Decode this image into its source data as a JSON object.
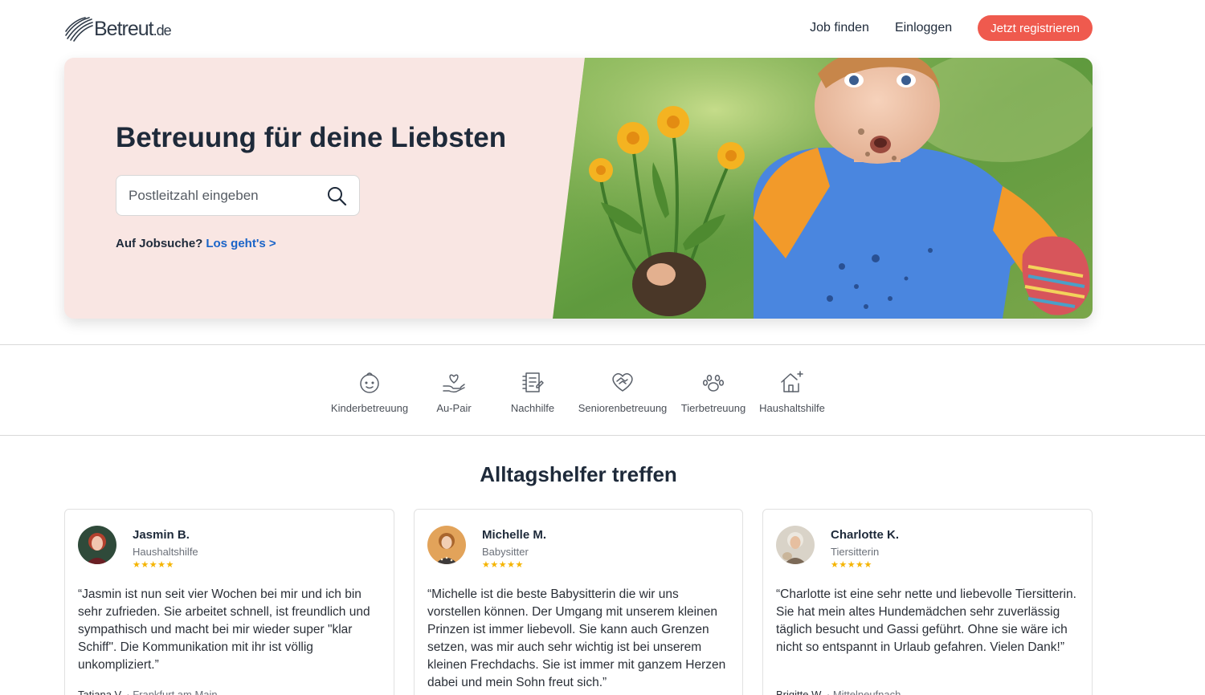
{
  "header": {
    "logo_text": "Betreut",
    "logo_tld": ".de",
    "nav": {
      "job_finden": "Job finden",
      "einloggen": "Einloggen",
      "register": "Jetzt registrieren"
    }
  },
  "hero": {
    "title": "Betreuung für deine Liebsten",
    "search_placeholder": "Postleitzahl eingeben",
    "job_prompt": "Auf Jobsuche?",
    "job_link": "Los geht's >"
  },
  "categories": [
    {
      "label": "Kinderbetreuung",
      "icon": "child-face-icon"
    },
    {
      "label": "Au-Pair",
      "icon": "hand-heart-icon"
    },
    {
      "label": "Nachhilfe",
      "icon": "notebook-icon"
    },
    {
      "label": "Seniorenbetreuung",
      "icon": "heart-handshake-icon"
    },
    {
      "label": "Tierbetreuung",
      "icon": "paw-icon"
    },
    {
      "label": "Haushaltshilfe",
      "icon": "house-sparkle-icon"
    }
  ],
  "section_title": "Alltagshelfer treffen",
  "reviews": [
    {
      "name": "Jasmin B.",
      "role": "Haushaltshilfe",
      "rating": 5,
      "quote": "“Jasmin ist nun seit vier Wochen bei mir und ich bin sehr zufrieden. Sie arbeitet schnell, ist freundlich und sympathisch und macht bei mir wieder super \"klar Schiff\". Die Kommunikation mit ihr ist völlig unkompliziert.”",
      "author": "Tatiana V.",
      "location": "Frankfurt am Main"
    },
    {
      "name": "Michelle M.",
      "role": "Babysitter",
      "rating": 5,
      "quote": "“Michelle ist die beste Babysitterin die wir uns vorstellen können. Der Umgang mit unserem kleinen Prinzen ist immer liebevoll. Sie kann auch Grenzen setzen, was mir auch sehr wichtig ist bei unserem kleinen Frechdachs. Sie ist immer mit ganzem Herzen dabei und mein Sohn freut sich.”",
      "author": "",
      "location": ""
    },
    {
      "name": "Charlotte K.",
      "role": "Tiersitterin",
      "rating": 5,
      "quote": "“Charlotte ist eine sehr nette und liebevolle Tiersitterin. Sie hat mein altes Hundemädchen sehr zuverlässig täglich besucht und Gassi geführt. Ohne sie wäre ich nicht so entspannt in Urlaub gefahren. Vielen Dank!”",
      "author": "Brigitte W.",
      "location": "Mittelneufnach"
    }
  ],
  "colors": {
    "brand_red": "#ef5a4e",
    "link_blue": "#1a64c8",
    "hero_bg": "#f9e6e3",
    "star": "#f5b400"
  }
}
